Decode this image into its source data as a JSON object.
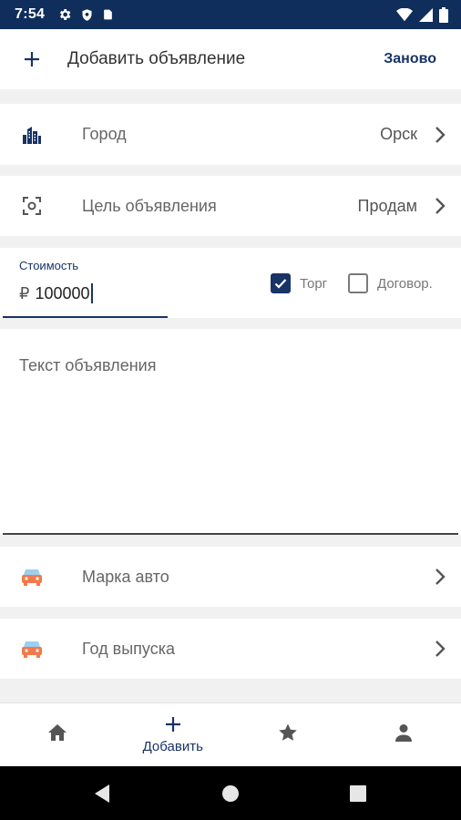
{
  "status_bar": {
    "time": "7:54"
  },
  "app_bar": {
    "title": "Добавить объявление",
    "reset_label": "Заново"
  },
  "city": {
    "label": "Город",
    "value": "Орск"
  },
  "purpose": {
    "label": "Цель объявления",
    "value": "Продам"
  },
  "price": {
    "label": "Стоимость",
    "currency": "₽",
    "value": "100000"
  },
  "bargain": {
    "label": "Торг",
    "checked": true
  },
  "contract": {
    "label": "Договор.",
    "checked": false
  },
  "description": {
    "placeholder": "Текст объявления"
  },
  "car_brand": {
    "label": "Марка авто"
  },
  "car_year": {
    "label": "Год выпуска"
  },
  "bottom_nav": {
    "add_label": "Добавить"
  },
  "colors": {
    "primary": "#183366",
    "status_bar": "#102e5c",
    "car_body": "#f4794a",
    "car_window": "#9ccff0"
  }
}
